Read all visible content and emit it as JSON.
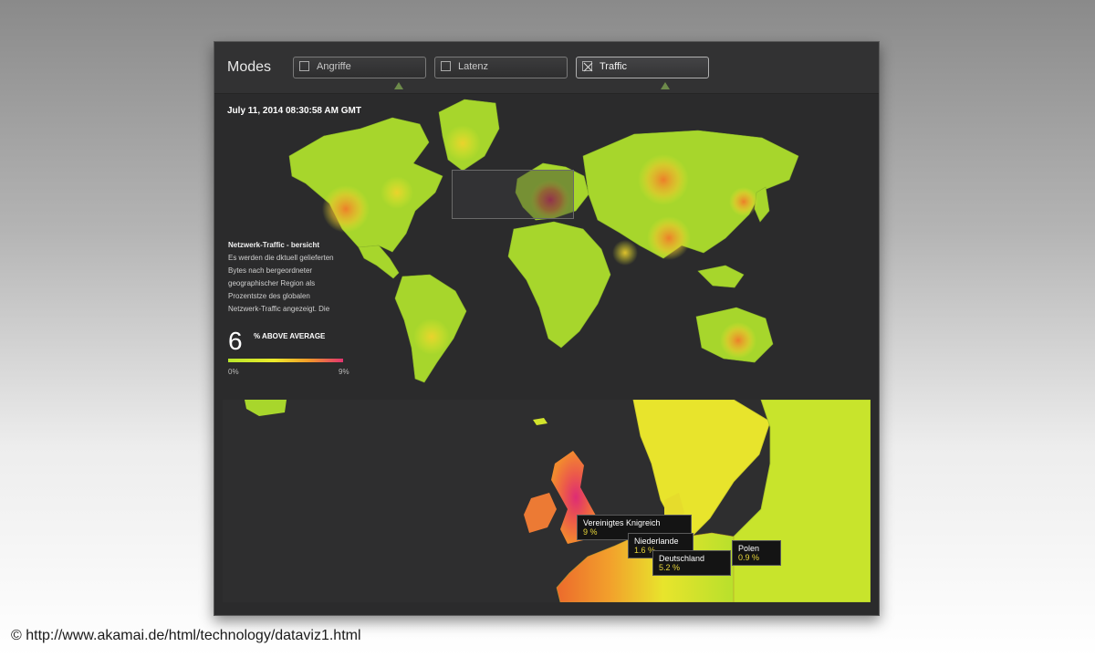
{
  "toolbar": {
    "title": "Modes",
    "modes": [
      {
        "label": "Angriffe",
        "checked": false
      },
      {
        "label": "Latenz",
        "checked": false
      },
      {
        "label": "Traffic",
        "checked": true
      }
    ]
  },
  "map": {
    "timestamp": "July 11, 2014 08:30:58 AM GMT",
    "info_title": "Netzwerk-Traffic - bersicht",
    "info_lines": [
      "Es werden die dktuell gelieferten",
      "Bytes nach bergeordneter",
      "geographischer Region als",
      "Prozentstze des globalen",
      "Netzwerk-Traffic angezeigt. Die"
    ],
    "stat_value": "6",
    "stat_label": "% ABOVE AVERAGE",
    "legend_min": "0%",
    "legend_max": "9%",
    "legend_colors": [
      "#b7e62b",
      "#ecea2b",
      "#f29a2a",
      "#e23470"
    ]
  },
  "detail": {
    "tooltips": [
      {
        "name": "Vereinigtes Knigreich",
        "value": "9 %"
      },
      {
        "name": "Niederlande",
        "value": "1.6 %"
      },
      {
        "name": "Deutschland",
        "value": "5.2 %"
      },
      {
        "name": "Polen",
        "value": "0.9 %"
      }
    ]
  },
  "footer": {
    "credit": "© http://www.akamai.de/html/technology/dataviz1.html"
  }
}
